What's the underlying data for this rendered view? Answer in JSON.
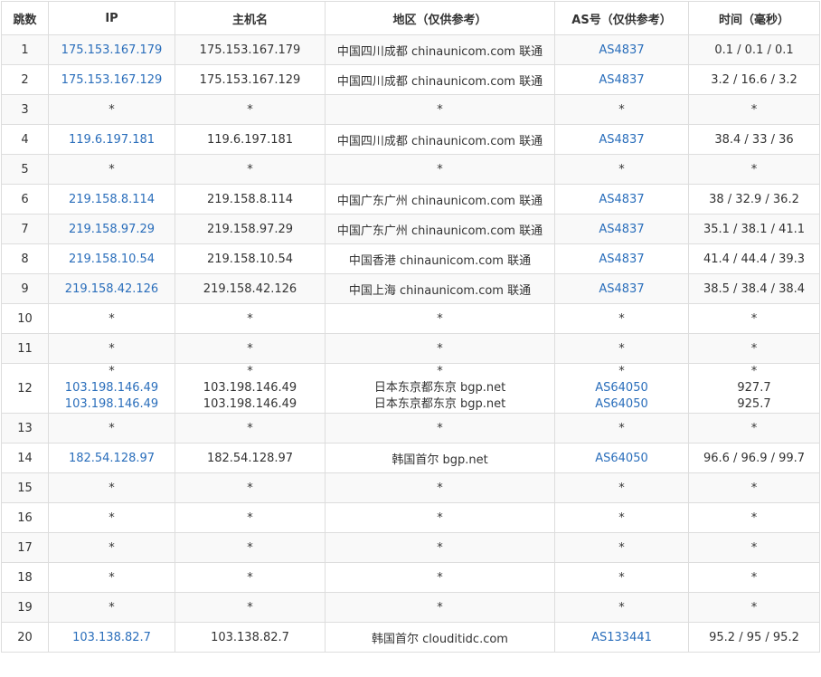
{
  "headers": {
    "hop": "跳数",
    "ip": "IP",
    "hostname": "主机名",
    "region": "地区（仅供参考）",
    "as": "AS号（仅供参考）",
    "time": "时间（毫秒）"
  },
  "rows": [
    {
      "hop": "1",
      "ip": "175.153.167.179",
      "host": "175.153.167.179",
      "region": "中国四川成都 chinaunicom.com 联通",
      "as": "AS4837",
      "time": "0.1 / 0.1 / 0.1"
    },
    {
      "hop": "2",
      "ip": "175.153.167.129",
      "host": "175.153.167.129",
      "region": "中国四川成都 chinaunicom.com 联通",
      "as": "AS4837",
      "time": "3.2 / 16.6 / 3.2"
    },
    {
      "hop": "3",
      "ip": "*",
      "host": "*",
      "region": "*",
      "as": "*",
      "time": "*"
    },
    {
      "hop": "4",
      "ip": "119.6.197.181",
      "host": "119.6.197.181",
      "region": "中国四川成都 chinaunicom.com 联通",
      "as": "AS4837",
      "time": "38.4 / 33 / 36"
    },
    {
      "hop": "5",
      "ip": "*",
      "host": "*",
      "region": "*",
      "as": "*",
      "time": "*"
    },
    {
      "hop": "6",
      "ip": "219.158.8.114",
      "host": "219.158.8.114",
      "region": "中国广东广州 chinaunicom.com 联通",
      "as": "AS4837",
      "time": "38 / 32.9 / 36.2"
    },
    {
      "hop": "7",
      "ip": "219.158.97.29",
      "host": "219.158.97.29",
      "region": "中国广东广州 chinaunicom.com 联通",
      "as": "AS4837",
      "time": "35.1 / 38.1 / 41.1"
    },
    {
      "hop": "8",
      "ip": "219.158.10.54",
      "host": "219.158.10.54",
      "region": "中国香港 chinaunicom.com 联通",
      "as": "AS4837",
      "time": "41.4 / 44.4 / 39.3"
    },
    {
      "hop": "9",
      "ip": "219.158.42.126",
      "host": "219.158.42.126",
      "region": "中国上海 chinaunicom.com 联通",
      "as": "AS4837",
      "time": "38.5 / 38.4 / 38.4"
    },
    {
      "hop": "10",
      "ip": "*",
      "host": "*",
      "region": "*",
      "as": "*",
      "time": "*"
    },
    {
      "hop": "11",
      "ip": "*",
      "host": "*",
      "region": "*",
      "as": "*",
      "time": "*"
    },
    {
      "hop": "12",
      "multi": [
        {
          "ip": "*",
          "host": "*",
          "region": "*",
          "as": "*",
          "time": "*"
        },
        {
          "ip": "103.198.146.49",
          "host": "103.198.146.49",
          "region": "日本东京都东京 bgp.net",
          "as": "AS64050",
          "time": "927.7"
        },
        {
          "ip": "103.198.146.49",
          "host": "103.198.146.49",
          "region": "日本东京都东京 bgp.net",
          "as": "AS64050",
          "time": "925.7"
        }
      ]
    },
    {
      "hop": "13",
      "ip": "*",
      "host": "*",
      "region": "*",
      "as": "*",
      "time": "*"
    },
    {
      "hop": "14",
      "ip": "182.54.128.97",
      "host": "182.54.128.97",
      "region": "韩国首尔 bgp.net",
      "as": "AS64050",
      "time": "96.6 / 96.9 / 99.7"
    },
    {
      "hop": "15",
      "ip": "*",
      "host": "*",
      "region": "*",
      "as": "*",
      "time": "*"
    },
    {
      "hop": "16",
      "ip": "*",
      "host": "*",
      "region": "*",
      "as": "*",
      "time": "*"
    },
    {
      "hop": "17",
      "ip": "*",
      "host": "*",
      "region": "*",
      "as": "*",
      "time": "*"
    },
    {
      "hop": "18",
      "ip": "*",
      "host": "*",
      "region": "*",
      "as": "*",
      "time": "*"
    },
    {
      "hop": "19",
      "ip": "*",
      "host": "*",
      "region": "*",
      "as": "*",
      "time": "*"
    },
    {
      "hop": "20",
      "ip": "103.138.82.7",
      "host": "103.138.82.7",
      "region": "韩国首尔 clouditidc.com",
      "as": "AS133441",
      "time": "95.2 / 95 / 95.2"
    }
  ],
  "colors": {
    "link": "#2a6ebb",
    "text": "#333333",
    "border": "#dddddd",
    "stripe": "#f9f9f9"
  }
}
